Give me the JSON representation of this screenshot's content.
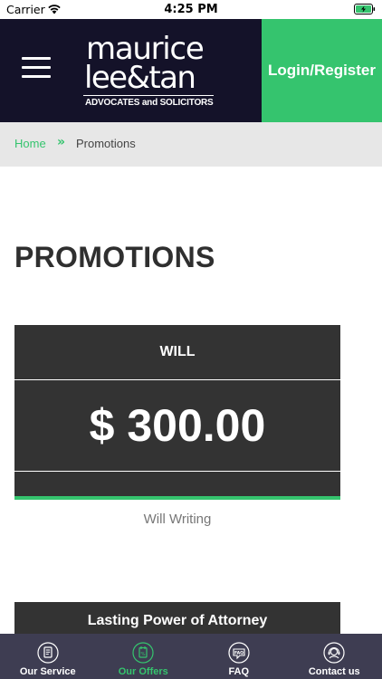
{
  "status_bar": {
    "carrier": "Carrier",
    "time": "4:25 PM"
  },
  "header": {
    "logo": {
      "line1": "maurice",
      "line2": "lee&tan",
      "tagline": "ADVOCATES and SOLICITORS"
    },
    "login_label": "Login/Register"
  },
  "breadcrumb": {
    "home": "Home",
    "separator": "»",
    "current": "Promotions"
  },
  "page": {
    "title": "PROMOTIONS",
    "promotions": [
      {
        "name": "WILL",
        "price": "$ 300.00",
        "description": "Will Writing"
      },
      {
        "name": "Lasting Power of Attorney"
      }
    ]
  },
  "tabbar": {
    "tabs": [
      {
        "label": "Our Service",
        "icon": "document-icon",
        "active": false
      },
      {
        "label": "Our Offers",
        "icon": "offers-icon",
        "active": true
      },
      {
        "label": "FAQ",
        "icon": "faq-icon",
        "active": false
      },
      {
        "label": "Contact us",
        "icon": "support-agent-icon",
        "active": false
      }
    ]
  },
  "colors": {
    "accent": "#35c46e",
    "header_bg": "#141229",
    "card_bg": "#333333",
    "tabbar_bg": "#3e3d52"
  }
}
